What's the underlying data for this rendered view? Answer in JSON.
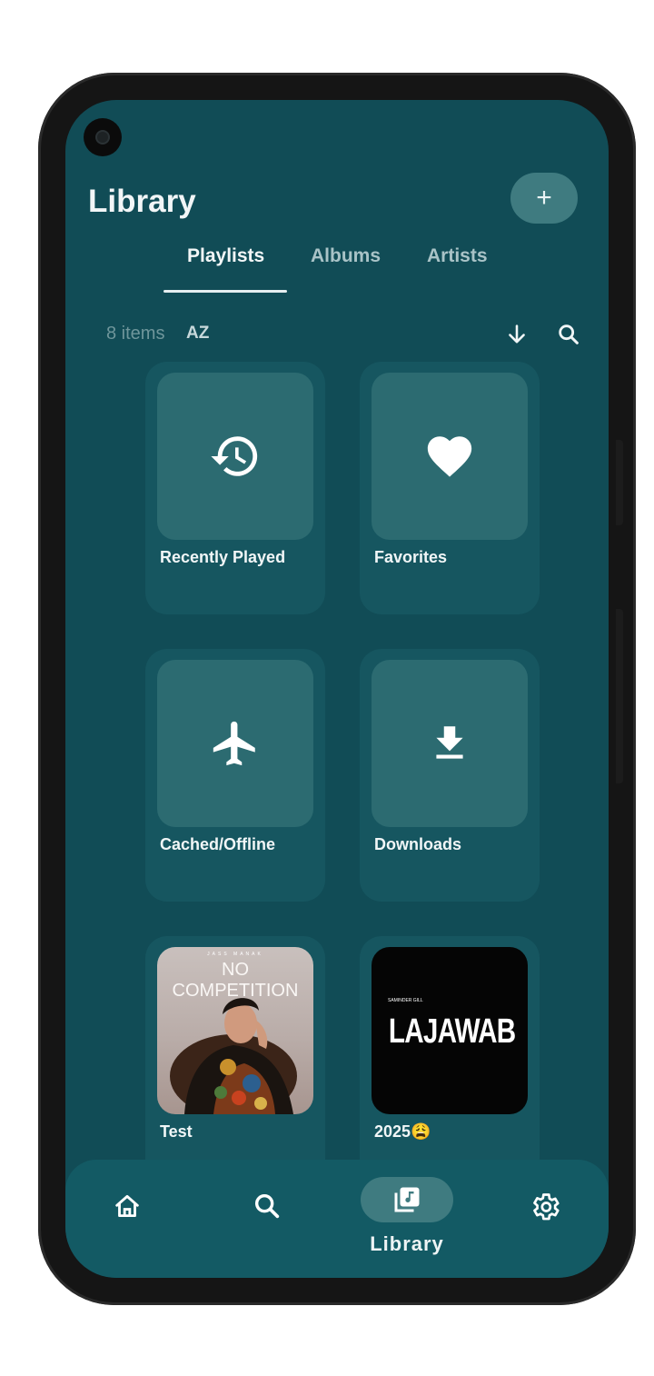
{
  "header": {
    "title": "Library",
    "add_label": "+"
  },
  "tabs": [
    {
      "label": "Playlists",
      "active": true
    },
    {
      "label": "Albums",
      "active": false
    },
    {
      "label": "Artists",
      "active": false
    }
  ],
  "toolbar": {
    "items_count": "8 items",
    "sort_label": "AZ"
  },
  "playlists": [
    {
      "name": "Recently Played",
      "icon": "history-icon"
    },
    {
      "name": "Favorites",
      "icon": "heart-icon"
    },
    {
      "name": "Cached/Offline",
      "icon": "airplane-icon"
    },
    {
      "name": "Downloads",
      "icon": "download-icon"
    },
    {
      "name": "Test",
      "cover_text": "NO COMPETITION",
      "cover_small": "JASS MANAK"
    },
    {
      "name": "2025😩",
      "cover_text": "LAJAWAB",
      "cover_small": "SAMINDER GILL"
    }
  ],
  "bottom_nav": {
    "items": [
      {
        "icon": "home-icon"
      },
      {
        "icon": "search-icon"
      },
      {
        "icon": "library-icon",
        "label": "Library",
        "active": true
      },
      {
        "icon": "settings-icon"
      }
    ]
  },
  "colors": {
    "background": "#114c56",
    "card": "#165660",
    "thumb": "#2c6b71",
    "accent": "#3f7b80"
  }
}
